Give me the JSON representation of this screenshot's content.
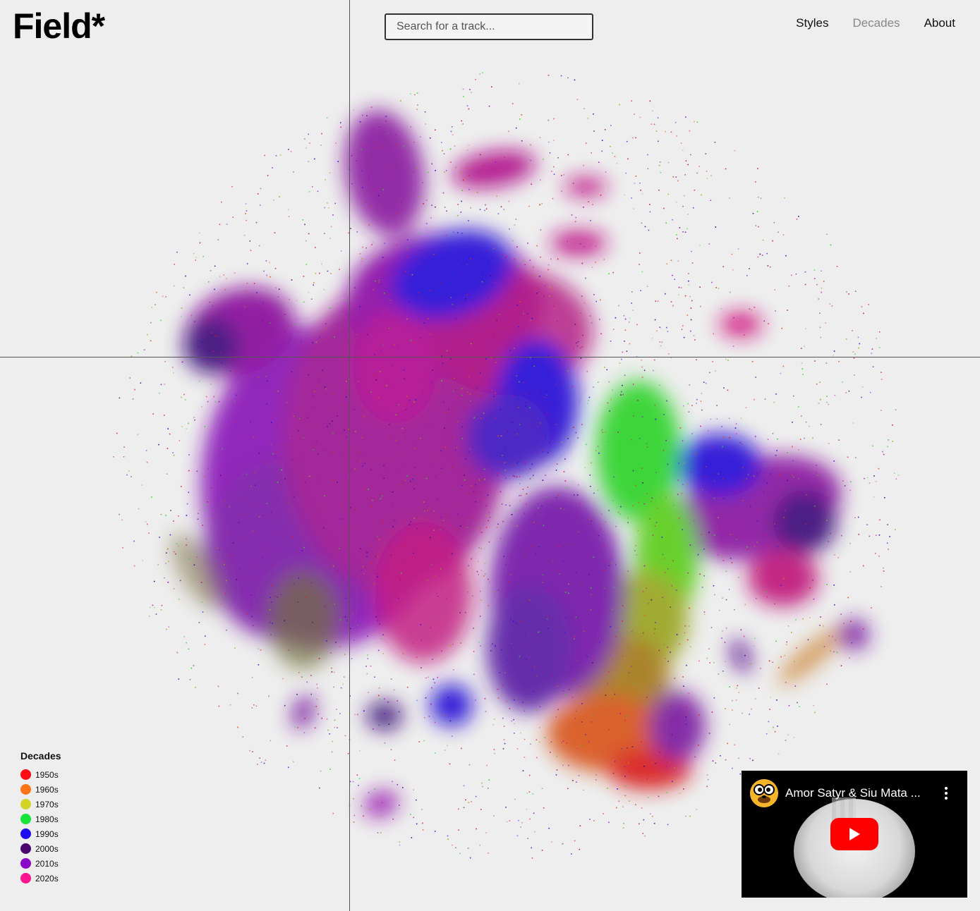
{
  "app": {
    "logo": "Field*"
  },
  "search": {
    "placeholder": "Search for a track...",
    "value": ""
  },
  "nav": {
    "items": [
      "Styles",
      "Decades",
      "About"
    ],
    "active": "Decades"
  },
  "legend": {
    "title": "Decades",
    "items": [
      {
        "label": "1950s",
        "color": "#ff0a15"
      },
      {
        "label": "1960s",
        "color": "#ff7417"
      },
      {
        "label": "1970s",
        "color": "#d3d425"
      },
      {
        "label": "1980s",
        "color": "#18e33a"
      },
      {
        "label": "1990s",
        "color": "#1d0df0"
      },
      {
        "label": "2000s",
        "color": "#4a066f"
      },
      {
        "label": "2010s",
        "color": "#8b0ac7"
      },
      {
        "label": "2020s",
        "color": "#ff138e"
      }
    ]
  },
  "video": {
    "title": "Amor Satyr & Siu Mata ...",
    "avatar_icon": "cartoon-face-icon",
    "menu_icon": "kebab-menu-icon",
    "play_icon": "youtube-play-icon"
  }
}
